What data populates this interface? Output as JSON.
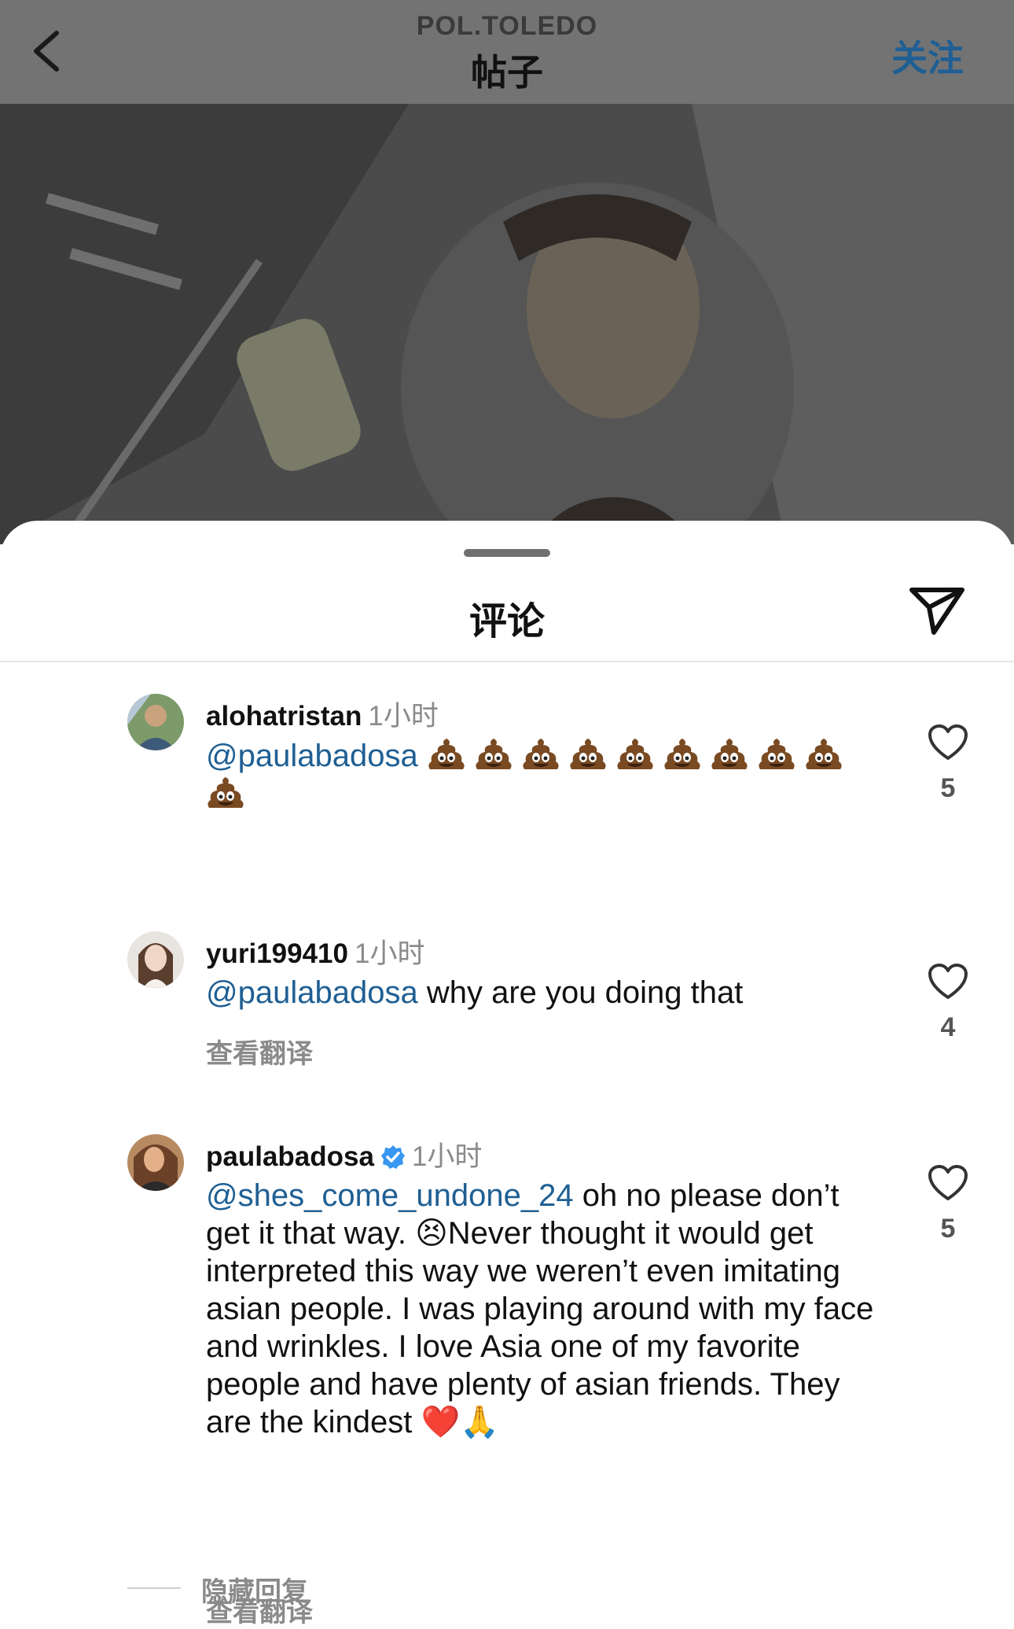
{
  "header": {
    "account": "POL.TOLEDO",
    "title": "帖子",
    "follow": "关注",
    "back_icon": "chevron-left-icon"
  },
  "sheet": {
    "title": "评论",
    "share_icon": "paper-plane-icon"
  },
  "comments": [
    {
      "username": "alohatristan",
      "time": "1小时",
      "mention": "@paulabadosa",
      "text": "",
      "emoji_count": 10,
      "emoji": "poop-emoji",
      "likes": "5",
      "translate": ""
    },
    {
      "username": "yuri199410",
      "time": "1小时",
      "mention": "@paulabadosa",
      "text": " why are you doing that",
      "likes": "4",
      "translate": "查看翻译"
    },
    {
      "username": "paulabadosa",
      "verified": true,
      "time": "1小时",
      "mention": "@shes_come_undone_24",
      "text_a": " oh no please don’t get it that way. ",
      "emoji_a": "😣",
      "text_b": "Never thought it would get interpreted this way we weren’t even imitating asian people. I was playing around with my face and wrinkles. I love Asia one of my favorite people and have plenty of asian friends. They are the kindest ",
      "emoji_b": "❤️",
      "emoji_c": "🙏",
      "likes": "5",
      "translate": "查看翻译"
    }
  ],
  "hide_replies": "隐藏回复",
  "colors": {
    "accent": "#1f5f93",
    "header_bg": "#737373",
    "muted": "#8a8a8a"
  }
}
